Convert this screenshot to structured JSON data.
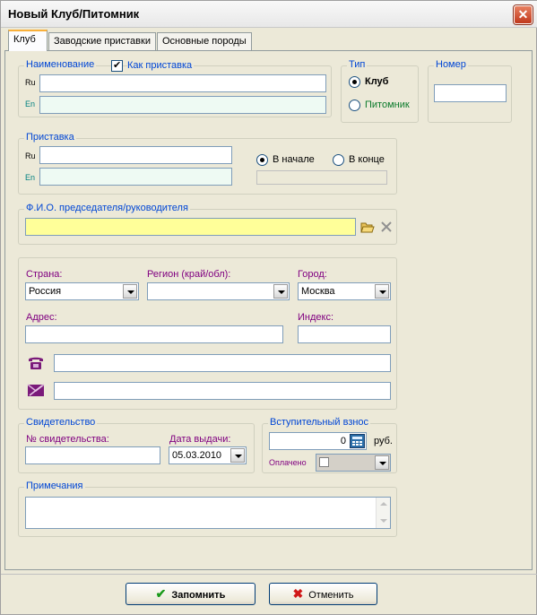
{
  "window": {
    "title": "Новый Клуб/Питомник",
    "close": "✕"
  },
  "tabs": [
    {
      "label": "Клуб"
    },
    {
      "label": "Заводские приставки"
    },
    {
      "label": "Основные породы"
    }
  ],
  "name_group": {
    "legend": "Наименование",
    "as_prefix_label": "Как приставка",
    "as_prefix_checked": true,
    "ru_label": "Ru",
    "en_label": "En",
    "ru_value": "",
    "en_value": ""
  },
  "type_group": {
    "legend": "Тип",
    "options": [
      {
        "label": "Клуб",
        "selected": true
      },
      {
        "label": "Питомник",
        "selected": false
      }
    ]
  },
  "number_group": {
    "legend": "Номер",
    "value": ""
  },
  "prefix_group": {
    "legend": "Приставка",
    "ru_label": "Ru",
    "en_label": "En",
    "ru_value": "",
    "en_value": "",
    "position_options": [
      {
        "label": "В начале",
        "selected": true
      },
      {
        "label": "В конце",
        "selected": false
      }
    ],
    "preview_value": ""
  },
  "chairman_group": {
    "legend": "Ф.И.О. председателя/руководителя",
    "value": ""
  },
  "address_group": {
    "country_label": "Страна:",
    "country_value": "Россия",
    "region_label": "Регион (край/обл):",
    "region_value": "",
    "city_label": "Город:",
    "city_value": "Москва",
    "address_label": "Адрес:",
    "address_value": "",
    "index_label": "Индекс:",
    "index_value": "",
    "phone_value": "",
    "email_value": ""
  },
  "certificate_group": {
    "legend": "Свидетельство",
    "number_label": "№ свидетельства:",
    "number_value": "",
    "date_label": "Дата выдачи:",
    "date_value": "05.03.2010"
  },
  "fee_group": {
    "legend": "Вступительный взнос",
    "amount": "0",
    "currency": "руб.",
    "paid_label": "Оплачено"
  },
  "notes_group": {
    "legend": "Примечания",
    "value": ""
  },
  "buttons": {
    "save": "Запомнить",
    "cancel": "Отменить"
  },
  "colors": {
    "accent_blue": "#0046d5",
    "purple": "#800080",
    "teal": "#008080",
    "yellow_field": "#ffff99"
  }
}
